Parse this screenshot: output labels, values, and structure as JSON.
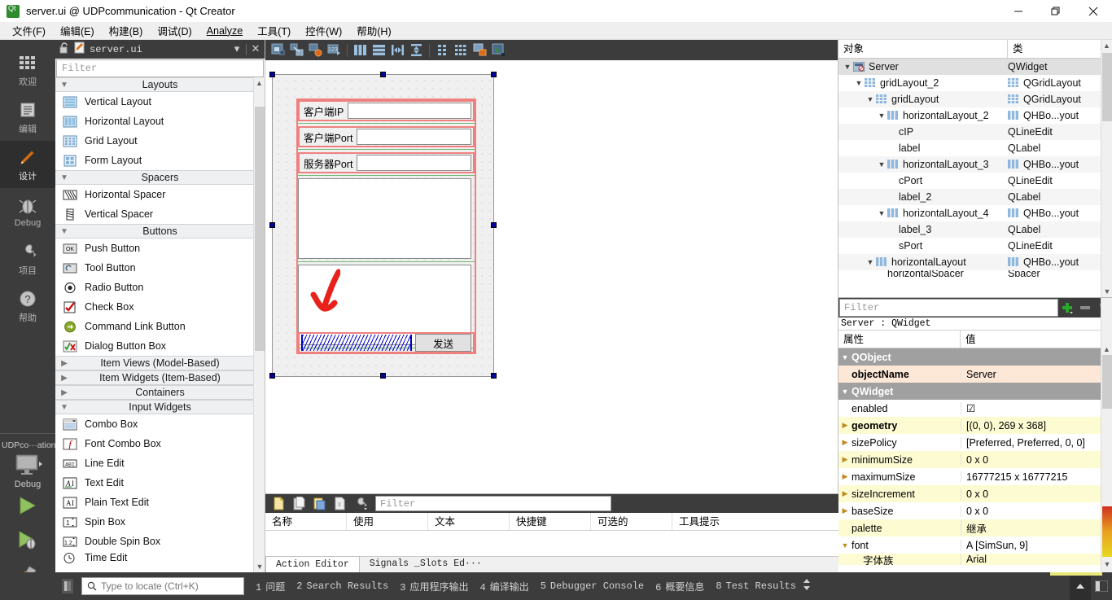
{
  "window": {
    "title": "server.ui @ UDPcommunication - Qt Creator",
    "app_icon": "qt-logo-icon",
    "minimize": "—",
    "maximize": "❐",
    "close": "✕"
  },
  "menubar": [
    {
      "label": "文件(F)",
      "key": "F"
    },
    {
      "label": "编辑(E)",
      "key": "E"
    },
    {
      "label": "构建(B)",
      "key": "B"
    },
    {
      "label": "调试(D)",
      "key": "D"
    },
    {
      "label": "Analyze",
      "key": "A"
    },
    {
      "label": "工具(T)",
      "key": "T"
    },
    {
      "label": "控件(W)",
      "key": "W"
    },
    {
      "label": "帮助(H)",
      "key": "H"
    }
  ],
  "modebar": {
    "modes": [
      {
        "label": "欢迎",
        "icon": "grid-squares-icon",
        "active": false
      },
      {
        "label": "编辑",
        "icon": "document-lines-icon",
        "active": false
      },
      {
        "label": "设计",
        "icon": "pencil-icon",
        "active": true
      },
      {
        "label": "Debug",
        "icon": "bug-icon",
        "active": false
      },
      {
        "label": "项目",
        "icon": "wrench-icon",
        "active": false
      },
      {
        "label": "帮助",
        "icon": "question-circle-icon",
        "active": false
      }
    ],
    "project_name": "UDPco···ation",
    "kit_label": "Debug",
    "kit_icon": "monitor-icon",
    "run_icon": "play-triangle-icon",
    "debug_icon": "play-bug-icon",
    "build_icon": "hammer-icon"
  },
  "widgetbox": {
    "header_title": "server.ui",
    "header_lock_icon": "unlocked-padlock-icon",
    "header_file_icon": "ui-file-icon",
    "header_dropdown_icon": "chevron-down-icon",
    "header_close_icon": "close-icon",
    "filter_placeholder": "Filter",
    "groups": [
      {
        "name": "Layouts",
        "expanded": true,
        "items": [
          {
            "label": "Vertical Layout",
            "icon": "vertical-layout-icon"
          },
          {
            "label": "Horizontal Layout",
            "icon": "horizontal-layout-icon"
          },
          {
            "label": "Grid Layout",
            "icon": "grid-layout-icon"
          },
          {
            "label": "Form Layout",
            "icon": "form-layout-icon"
          }
        ]
      },
      {
        "name": "Spacers",
        "expanded": true,
        "items": [
          {
            "label": "Horizontal Spacer",
            "icon": "horizontal-spacer-icon"
          },
          {
            "label": "Vertical Spacer",
            "icon": "vertical-spacer-icon"
          }
        ]
      },
      {
        "name": "Buttons",
        "expanded": true,
        "items": [
          {
            "label": "Push Button",
            "icon": "push-button-icon"
          },
          {
            "label": "Tool Button",
            "icon": "tool-button-icon"
          },
          {
            "label": "Radio Button",
            "icon": "radio-button-icon"
          },
          {
            "label": "Check Box",
            "icon": "check-box-icon"
          },
          {
            "label": "Command Link Button",
            "icon": "command-link-icon"
          },
          {
            "label": "Dialog Button Box",
            "icon": "dialog-button-box-icon"
          }
        ]
      },
      {
        "name": "Item Views (Model-Based)",
        "expanded": false,
        "items": []
      },
      {
        "name": "Item Widgets (Item-Based)",
        "expanded": false,
        "items": []
      },
      {
        "name": "Containers",
        "expanded": false,
        "items": []
      },
      {
        "name": "Input Widgets",
        "expanded": true,
        "items": [
          {
            "label": "Combo Box",
            "icon": "combo-box-icon"
          },
          {
            "label": "Font Combo Box",
            "icon": "font-combo-box-icon"
          },
          {
            "label": "Line Edit",
            "icon": "line-edit-icon"
          },
          {
            "label": "Text Edit",
            "icon": "text-edit-icon"
          },
          {
            "label": "Plain Text Edit",
            "icon": "plain-text-edit-icon"
          },
          {
            "label": "Spin Box",
            "icon": "spin-box-icon"
          },
          {
            "label": "Double Spin Box",
            "icon": "double-spin-box-icon"
          },
          {
            "label": "Time Edit",
            "icon": "time-edit-icon"
          }
        ]
      }
    ]
  },
  "designer_toolbar": [
    {
      "icon": "edit-widgets-icon"
    },
    {
      "icon": "edit-signals-slots-icon"
    },
    {
      "icon": "edit-buddies-icon"
    },
    {
      "icon": "edit-tab-order-icon"
    },
    {
      "icon": "layout-horizontally-icon"
    },
    {
      "icon": "layout-vertically-icon"
    },
    {
      "icon": "layout-splitter-horizontal-icon"
    },
    {
      "icon": "layout-splitter-vertical-icon"
    },
    {
      "icon": "layout-form-icon"
    },
    {
      "icon": "layout-grid-icon"
    },
    {
      "icon": "break-layout-icon"
    },
    {
      "icon": "adjust-size-icon"
    }
  ],
  "form": {
    "widgets": [
      {
        "name": "label",
        "type": "QLabel",
        "text": "客户端IP"
      },
      {
        "name": "cIP",
        "type": "QLineEdit",
        "text": ""
      },
      {
        "name": "label_2",
        "type": "QLabel",
        "text": "客户端Port"
      },
      {
        "name": "cPort",
        "type": "QLineEdit",
        "text": ""
      },
      {
        "name": "label_3",
        "type": "QLabel",
        "text": "服务器Port"
      },
      {
        "name": "sPort",
        "type": "QLineEdit",
        "text": ""
      },
      {
        "name": "textEdit_recv",
        "type": "QTextEdit",
        "text": ""
      },
      {
        "name": "textEdit_send",
        "type": "QTextEdit",
        "text": ""
      },
      {
        "name": "horizontalSpacer",
        "type": "Spacer",
        "text": ""
      },
      {
        "name": "sendButton",
        "type": "QPushButton",
        "text": "发送"
      }
    ]
  },
  "action_editor": {
    "toolbar": [
      {
        "icon": "new-action-icon"
      },
      {
        "icon": "copy-action-icon"
      },
      {
        "icon": "paste-action-icon"
      },
      {
        "icon": "delete-action-icon"
      },
      {
        "icon": "configure-icon"
      }
    ],
    "filter_placeholder": "Filter",
    "columns": [
      "名称",
      "使用",
      "文本",
      "快捷键",
      "可选的",
      "工具提示"
    ],
    "rows": [],
    "tabs": [
      {
        "label": "Action Editor",
        "active": true
      },
      {
        "label": "Signals _Slots Ed···",
        "active": false
      }
    ]
  },
  "object_inspector": {
    "columns": [
      "对象",
      "类"
    ],
    "rows": [
      {
        "indent": 0,
        "name": "Server",
        "class": "QWidget",
        "chev": "down",
        "icon": "widget-icon",
        "selected": true,
        "class_icon": false
      },
      {
        "indent": 1,
        "name": "gridLayout_2",
        "class": "QGridLayout",
        "chev": "down",
        "icon": "grid-layout-icon",
        "selected": false,
        "class_icon": true
      },
      {
        "indent": 2,
        "name": "gridLayout",
        "class": "QGridLayout",
        "chev": "down",
        "icon": "grid-layout-icon",
        "selected": false,
        "class_icon": true
      },
      {
        "indent": 3,
        "name": "horizontalLayout_2",
        "class": "QHBo...yout",
        "chev": "down",
        "icon": "horizontal-layout-icon",
        "selected": false,
        "class_icon": true
      },
      {
        "indent": 5,
        "name": "cIP",
        "class": "QLineEdit",
        "chev": "",
        "icon": "",
        "selected": false,
        "class_icon": false
      },
      {
        "indent": 5,
        "name": "label",
        "class": "QLabel",
        "chev": "",
        "icon": "",
        "selected": false,
        "class_icon": false
      },
      {
        "indent": 3,
        "name": "horizontalLayout_3",
        "class": "QHBo...yout",
        "chev": "down",
        "icon": "horizontal-layout-icon",
        "selected": false,
        "class_icon": true
      },
      {
        "indent": 5,
        "name": "cPort",
        "class": "QLineEdit",
        "chev": "",
        "icon": "",
        "selected": false,
        "class_icon": false
      },
      {
        "indent": 5,
        "name": "label_2",
        "class": "QLabel",
        "chev": "",
        "icon": "",
        "selected": false,
        "class_icon": false
      },
      {
        "indent": 3,
        "name": "horizontalLayout_4",
        "class": "QHBo...yout",
        "chev": "down",
        "icon": "horizontal-layout-icon",
        "selected": false,
        "class_icon": true
      },
      {
        "indent": 5,
        "name": "label_3",
        "class": "QLabel",
        "chev": "",
        "icon": "",
        "selected": false,
        "class_icon": false
      },
      {
        "indent": 5,
        "name": "sPort",
        "class": "QLineEdit",
        "chev": "",
        "icon": "",
        "selected": false,
        "class_icon": false
      },
      {
        "indent": 2,
        "name": "horizontalLayout",
        "class": "QHBo...yout",
        "chev": "down",
        "icon": "horizontal-layout-icon",
        "selected": false,
        "class_icon": true
      },
      {
        "indent": 4,
        "name": "horizontalSpacer",
        "class": "Spacer",
        "chev": "",
        "icon": "",
        "selected": false,
        "class_icon": false
      }
    ]
  },
  "property_editor": {
    "filter_placeholder": "Filter",
    "add_icon": "plus-icon",
    "remove_icon": "minus-icon",
    "configure_icon": "wrench-icon",
    "object_line": "Server : QWidget",
    "columns": [
      "属性",
      "值"
    ],
    "rows": [
      {
        "name": "QObject",
        "value": "",
        "kind": "group",
        "chev": "down"
      },
      {
        "name": "objectName",
        "value": "Server",
        "kind": "orange",
        "chev": ""
      },
      {
        "name": "QWidget",
        "value": "",
        "kind": "group",
        "chev": "down"
      },
      {
        "name": "enabled",
        "value": "☑",
        "kind": "white",
        "chev": ""
      },
      {
        "name": "geometry",
        "value": "[(0, 0), 269 x 368]",
        "kind": "yellow",
        "chev": "right",
        "bold": true
      },
      {
        "name": "sizePolicy",
        "value": "[Preferred, Preferred, 0, 0]",
        "kind": "white",
        "chev": "right"
      },
      {
        "name": "minimumSize",
        "value": "0 x 0",
        "kind": "yellow",
        "chev": "right"
      },
      {
        "name": "maximumSize",
        "value": "16777215 x 16777215",
        "kind": "white",
        "chev": "right"
      },
      {
        "name": "sizeIncrement",
        "value": "0 x 0",
        "kind": "yellow",
        "chev": "right"
      },
      {
        "name": "baseSize",
        "value": "0 x 0",
        "kind": "white",
        "chev": "right"
      },
      {
        "name": "palette",
        "value": "继承",
        "kind": "yellow",
        "chev": ""
      },
      {
        "name": "font",
        "value": "A   [SimSun, 9]",
        "kind": "white",
        "chev": "down"
      },
      {
        "name": "字体族",
        "value": "Arial",
        "kind": "yellow",
        "chev": "",
        "sub": true
      }
    ]
  },
  "statusbar": {
    "locator_placeholder": "Type to locate (Ctrl+K)",
    "search_icon": "magnifier-icon",
    "items": [
      {
        "num": "1",
        "label": "问题"
      },
      {
        "num": "2",
        "label": "Search Results"
      },
      {
        "num": "3",
        "label": "应用程序输出"
      },
      {
        "num": "4",
        "label": "编译输出"
      },
      {
        "num": "5",
        "label": "Debugger Console"
      },
      {
        "num": "6",
        "label": "概要信息"
      },
      {
        "num": "8",
        "label": "Test Results"
      }
    ],
    "updown_icon": "up-down-arrow-icon",
    "collapse_icon": "triangle-up-icon",
    "panel_icon": "split-panel-icon"
  },
  "colors": {
    "dark_chrome": "#3c3c3c",
    "mode_active": "#2e2e2e",
    "layout_red": "#f08080",
    "layout_green": "#73b873",
    "spacer_blue": "#0000c8",
    "handle_blue": "#0000a0",
    "annotation_red": "#e8211b",
    "property_yellow": "#fdfbd2",
    "property_orange": "#fde8d8",
    "group_gray": "#a0a0a0"
  }
}
